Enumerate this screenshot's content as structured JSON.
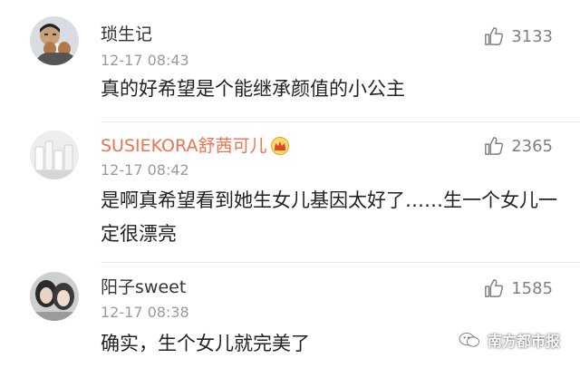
{
  "comments": [
    {
      "username": "琐生记",
      "timestamp": "12-17 08:43",
      "likes": "3133",
      "text": "真的好希望是个能继承颜值的小公主",
      "avatar_icon": "man-with-dog-avatar"
    },
    {
      "username": "SUSIEKORA舒茜可儿",
      "timestamp": "12-17 08:42",
      "likes": "2365",
      "text": "是啊真希望看到她生女儿基因太好了……生一个女儿一定很漂亮",
      "badge_icon": "crown-icon",
      "avatar_icon": "cosmetics-bottles-avatar"
    },
    {
      "username": "阳子sweet",
      "timestamp": "12-17 08:38",
      "likes": "1585",
      "text": "确实，生个女儿就完美了",
      "avatar_icon": "two-girls-avatar"
    }
  ],
  "watermark": {
    "text": "南方都市报",
    "icon": "wechat-logo-icon"
  },
  "colors": {
    "vip_name": "#eb7350",
    "timestamp": "#9a9a9a",
    "like": "#808080"
  }
}
